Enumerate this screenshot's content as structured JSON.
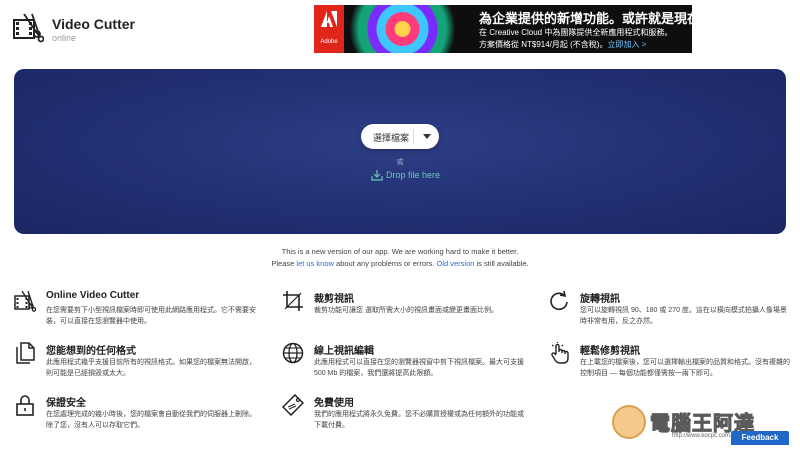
{
  "header": {
    "title": "Video Cutter",
    "subtitle": "online"
  },
  "ad": {
    "brand": "Adobe",
    "headline": "為企業提供的新增功能。或許就是現在！",
    "line1": "在 Creative Cloud 中為團隊提供全新應用程式和服務。",
    "line2_prefix": "方案價格從 NT$914/月起 (不含稅)。",
    "line2_link": "立即加入 >"
  },
  "upload": {
    "choose_label": "選擇檔案",
    "or_label": "或",
    "drop_label": "Drop file here"
  },
  "notice": {
    "line1": "This is a new version of our app. We are working hard to make it better.",
    "line2_pre": "Please ",
    "line2_link1": "let us know",
    "line2_mid": " about any problems or errors. ",
    "line2_link2": "Old version",
    "line2_post": " is still available."
  },
  "features": [
    {
      "icon": "film-scissors-icon",
      "title": "Online Video Cutter",
      "desc": "在您需要剪下小型視訊檔案時即可使用此網路應用程式。它不需要安裝，可以直接在您瀏覽器中使用。"
    },
    {
      "icon": "crop-icon",
      "title": "裁剪視訊",
      "desc": "裁剪功能可讓您 選取所需大小的視訊畫面或變更畫面比例。"
    },
    {
      "icon": "rotate-icon",
      "title": "旋轉視訊",
      "desc": "您可以旋轉視訊 90、180 或 270 度。這在以橫向模式拍攝人像場景時非常有用，反之亦然。"
    },
    {
      "icon": "files-icon",
      "title": "您能想到的任何格式",
      "desc": "此應用程式幾乎支援目前所有的視訊格式。如果您的檔案無法開啟，則可能是已經損毀或太大。"
    },
    {
      "icon": "globe-icon",
      "title": "線上視訊編輯",
      "desc": "此應用程式可以直接在您的瀏覽器視窗中剪下視訊檔案。最大可支援 500 Mb 的檔案，我們還將提高此限額。"
    },
    {
      "icon": "hand-pointer-icon",
      "title": "輕鬆修剪視訊",
      "desc": "在上載您的檔案後，您可以選擇輸出檔案的品質和格式。沒有複雜的控制項目 — 每個功能都僅需按一兩下即可。"
    },
    {
      "icon": "lock-icon",
      "title": "保證安全",
      "desc": "在您處理完成的幾小時後，您的檔案會自動從我們的伺服器上刪除。除了您，沒有人可以存取它們。"
    },
    {
      "icon": "free-tag-icon",
      "title": "免費使用",
      "desc": "我們的應用程式將永久免費。您不必購買授權或為任何額外的功能或下載付費。"
    }
  ],
  "watermark": {
    "text": "電腦王阿達",
    "url": "http://www.kocpc.com.tw"
  },
  "feedback_label": "Feedback",
  "colors": {
    "hero_bg": "#233276",
    "accent_link": "#2d6bd2",
    "drop_text": "#6cc6b8",
    "feedback_bg": "#1f68c7"
  }
}
